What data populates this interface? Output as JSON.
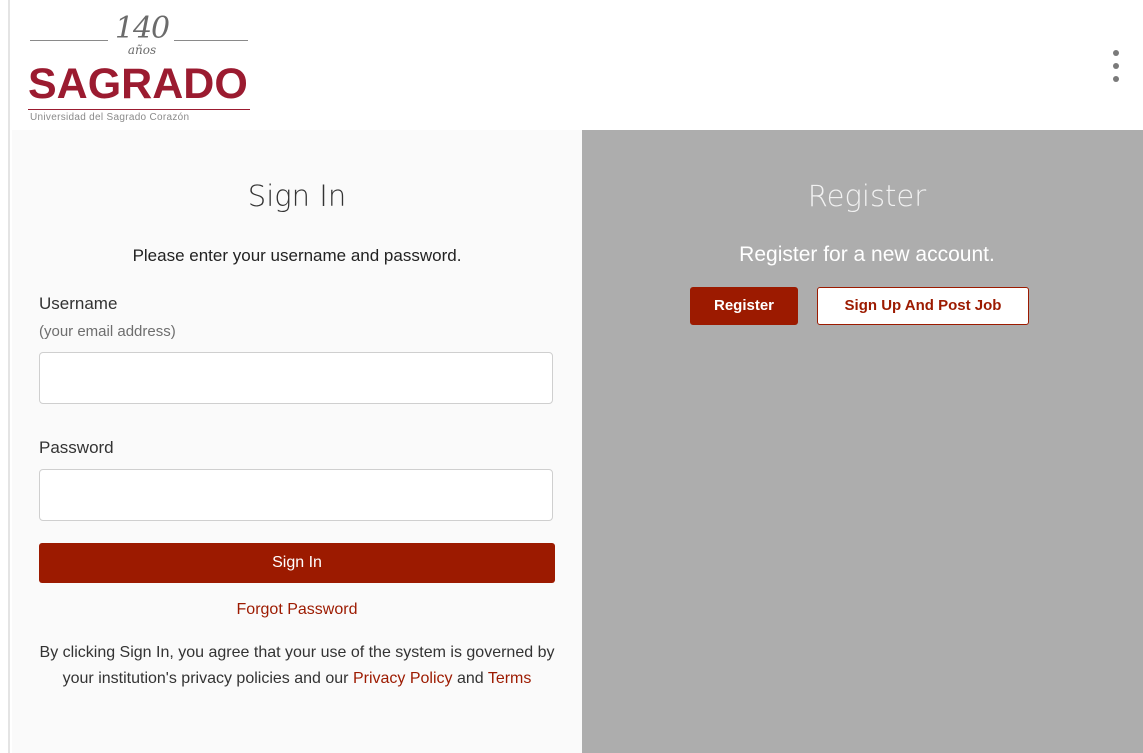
{
  "header": {
    "logo": {
      "years": "140",
      "years_sub": "años",
      "name": "SAGRADO",
      "subtitle": "Universidad del Sagrado Corazón"
    },
    "menu_icon": "kebab-vertical-icon"
  },
  "signin": {
    "title": "Sign In",
    "instruction": "Please enter your username and password.",
    "username_label": "Username",
    "username_hint": "(your email address)",
    "username_value": "",
    "password_label": "Password",
    "password_value": "",
    "button_label": "Sign In",
    "forgot_password": "Forgot Password",
    "legal_text": "By clicking Sign In, you agree that your use of the system is governed by your institution's privacy policies and our ",
    "privacy_link": "Privacy Policy",
    "legal_and": " and ",
    "terms_link": "Terms"
  },
  "register": {
    "title": "Register",
    "instruction": "Register for a new account.",
    "register_button": "Register",
    "signup_post_button": "Sign Up And Post Job"
  },
  "colors": {
    "brand": "#9b1b30",
    "accent": "#9c1a00",
    "register_bg": "#adadad",
    "signin_bg": "#fafafa"
  }
}
